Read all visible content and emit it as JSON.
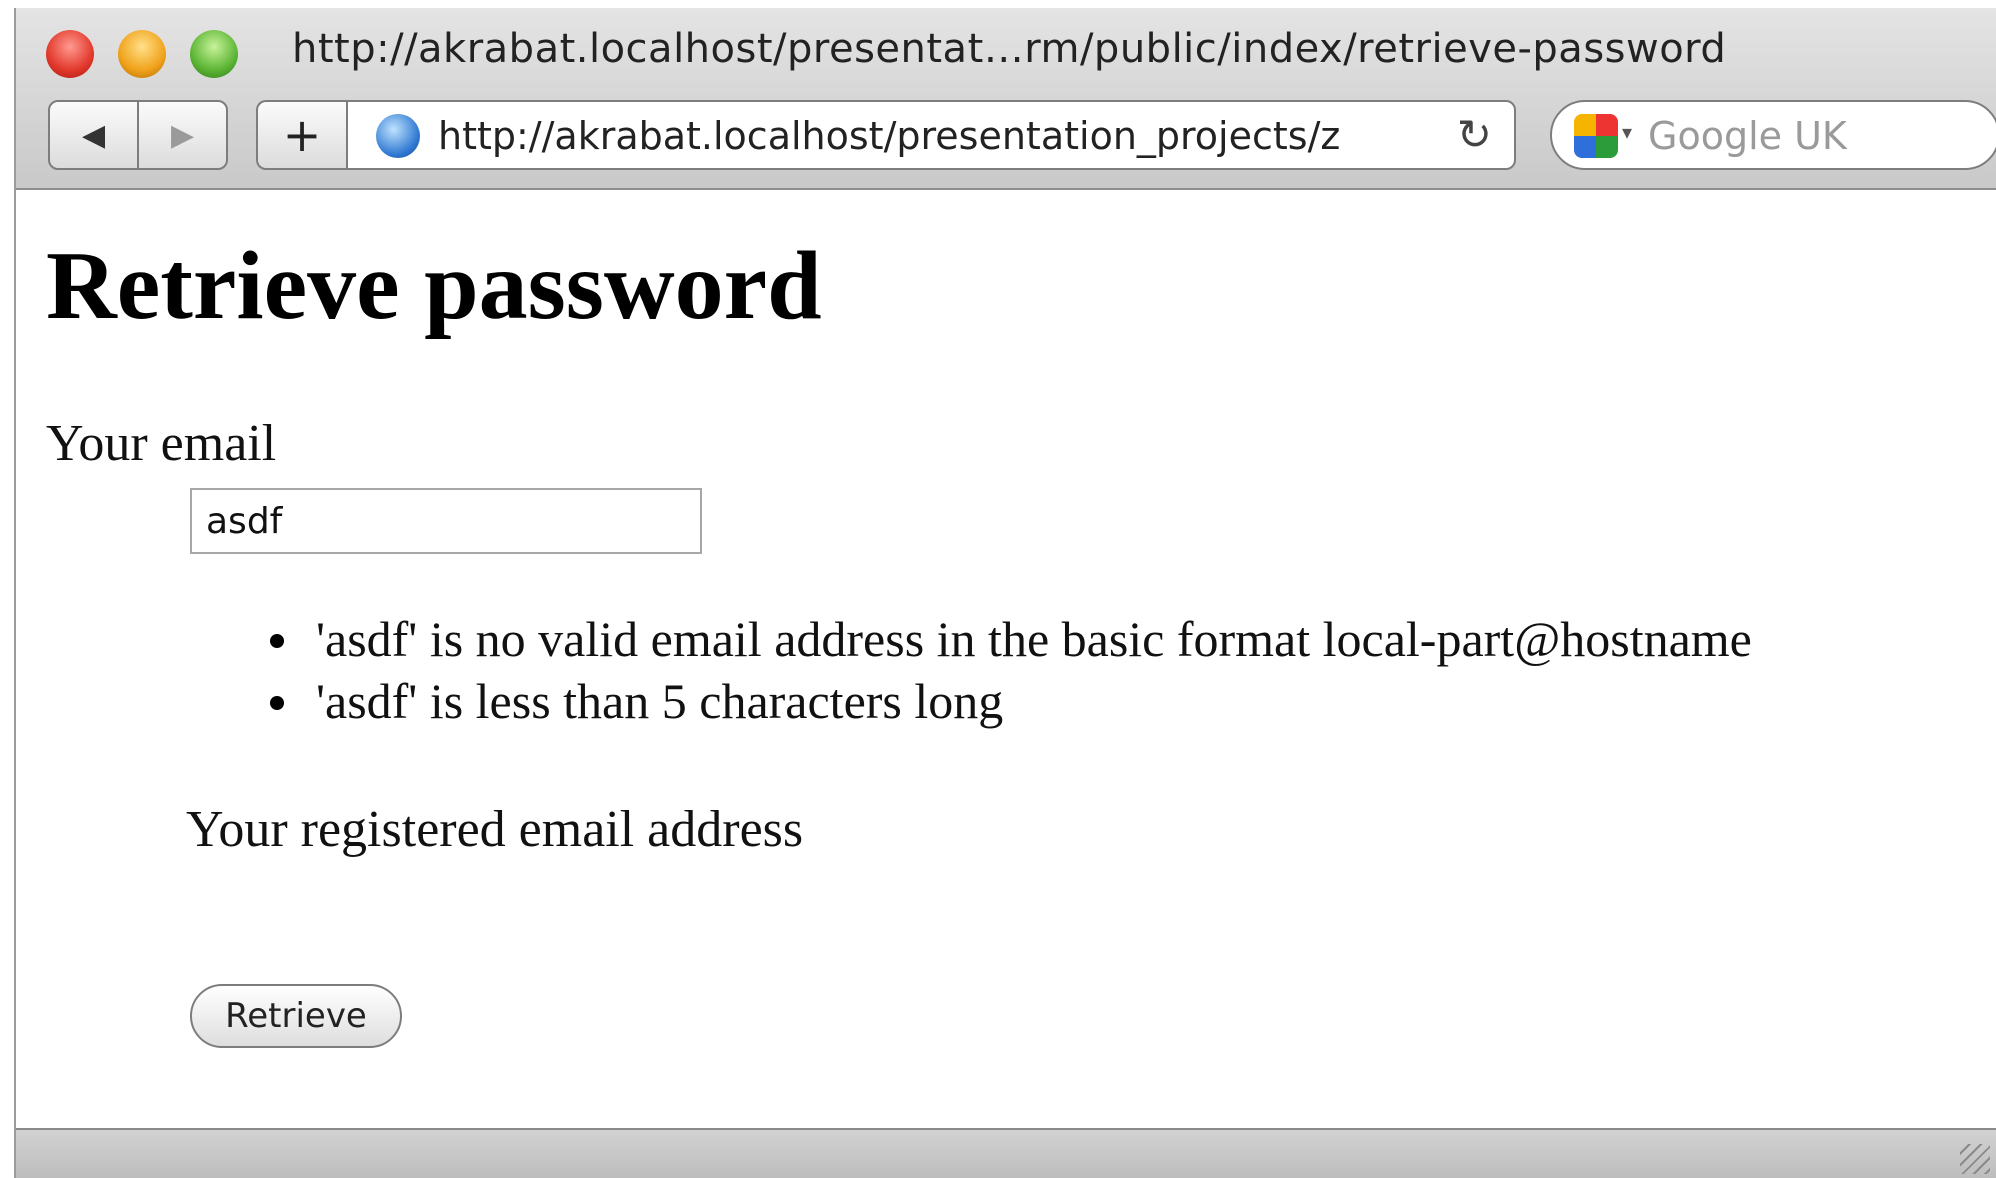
{
  "window": {
    "title": "http://akrabat.localhost/presentat…rm/public/index/retrieve-password"
  },
  "toolbar": {
    "back_icon": "◀",
    "forward_icon": "▶",
    "add_icon": "+",
    "url": "http://akrabat.localhost/presentation_projects/z",
    "reload_icon": "↻",
    "search_placeholder": "Google UK"
  },
  "page": {
    "heading": "Retrieve password",
    "email_label": "Your email",
    "email_value": "asdf",
    "errors": [
      "'asdf' is no valid email address in the basic format local-part@hostname",
      "'asdf' is less than 5 characters long"
    ],
    "email_description": "Your registered email address",
    "submit_label": "Retrieve"
  }
}
